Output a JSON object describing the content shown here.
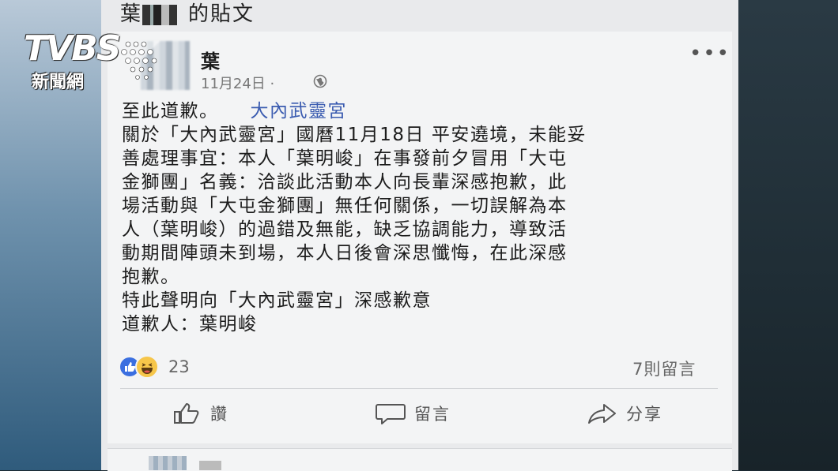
{
  "header": {
    "title_prefix": "葉",
    "title_suffix": "的貼文"
  },
  "post": {
    "author": "葉",
    "timestamp": "11月24日 ·",
    "lines": [
      "關於「大內武靈宮」國曆11月18日 平安遶境，未能妥",
      "善處理事宜：本人「葉明峻」在事發前夕冒用「大屯",
      "金獅團」名義：洽談此活動本人向長輩深感抱歉，此",
      "場活動與「大屯金獅團」無任何關係，一切誤解為本",
      "人（葉明峻）的過錯及無能，缺乏協調能力，導致活",
      "動期間陣頭未到場，本人日後會深思懺悔，在此深感",
      "抱歉。",
      "特此聲明向「大內武靈宮」深感歉意",
      "道歉人：葉明峻"
    ],
    "first_line": "至此道歉。",
    "tag": "大內武靈宮",
    "reaction_count": "23",
    "comment_count": "7則留言"
  },
  "actions": {
    "like": "讚",
    "comment": "留言",
    "share": "分享"
  },
  "logo": {
    "brand": "TVBS",
    "sub": "新聞網"
  },
  "colors": {
    "like_blue": "#3b6fe0",
    "haha_yellow": "#f6c64a",
    "tag_blue": "#3a5bb0"
  }
}
